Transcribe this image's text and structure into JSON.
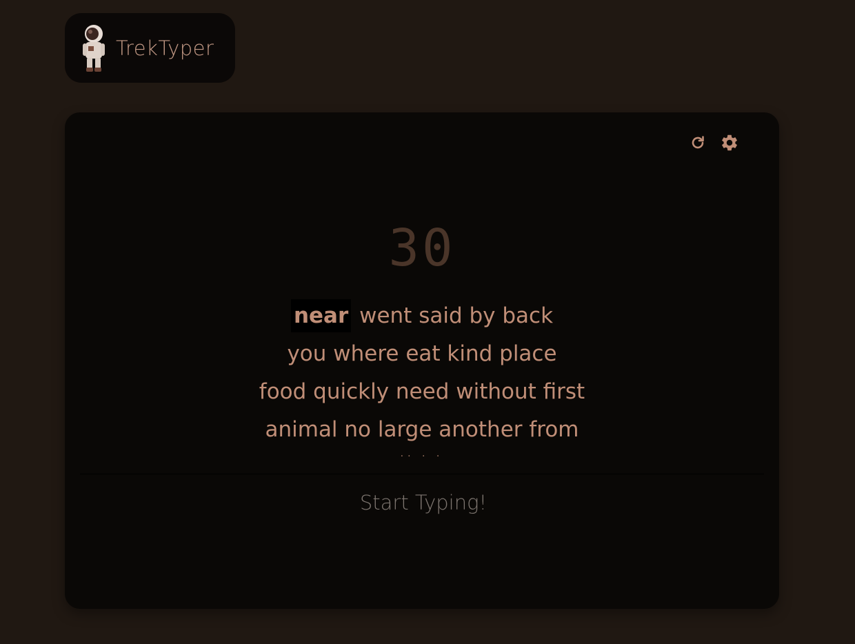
{
  "app": {
    "title": "TrekTyper",
    "logo_icon": "astronaut-icon"
  },
  "toolbar": {
    "restart_icon": "refresh-icon",
    "settings_icon": "gear-icon"
  },
  "test": {
    "countdown": "30",
    "current_word": "near",
    "lines": [
      "went said by back",
      "you where eat kind place",
      "food quickly need without first",
      "animal no large another from"
    ],
    "partial_line": ".. . ."
  },
  "input": {
    "placeholder": "Start Typing!"
  },
  "colors": {
    "background": "#201812",
    "card": "#0a0806",
    "accent": "#c08e77",
    "timer": "#4a3529",
    "placeholder": "#7e7670"
  }
}
